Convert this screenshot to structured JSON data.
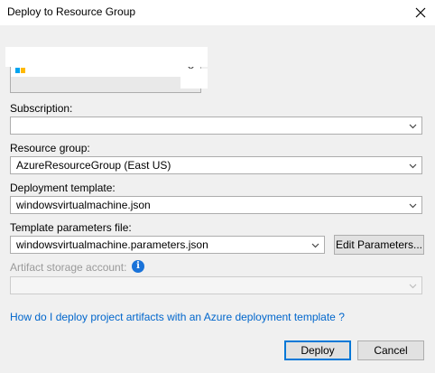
{
  "window": {
    "title": "Deploy to Resource Group"
  },
  "account": {
    "value": ""
  },
  "subscription": {
    "label": "Subscription:",
    "value": ""
  },
  "resource_group": {
    "label": "Resource group:",
    "value": "AzureResourceGroup (East US)"
  },
  "deployment_template": {
    "label": "Deployment template:",
    "value": "windowsvirtualmachine.json"
  },
  "template_parameters": {
    "label": "Template parameters file:",
    "value": "windowsvirtualmachine.parameters.json",
    "edit_label": "Edit Parameters..."
  },
  "artifact_storage": {
    "label": "Artifact storage account:",
    "value": ""
  },
  "help_link": "How do I deploy project artifacts with an Azure deployment template ?",
  "buttons": {
    "deploy": "Deploy",
    "cancel": "Cancel"
  },
  "icons": {
    "close": "close-icon",
    "info": "info-icon",
    "dropdown": "chevron-down-icon"
  },
  "colors": {
    "accent": "#0078d7",
    "link": "#0066cc",
    "info": "#1a73d9"
  }
}
